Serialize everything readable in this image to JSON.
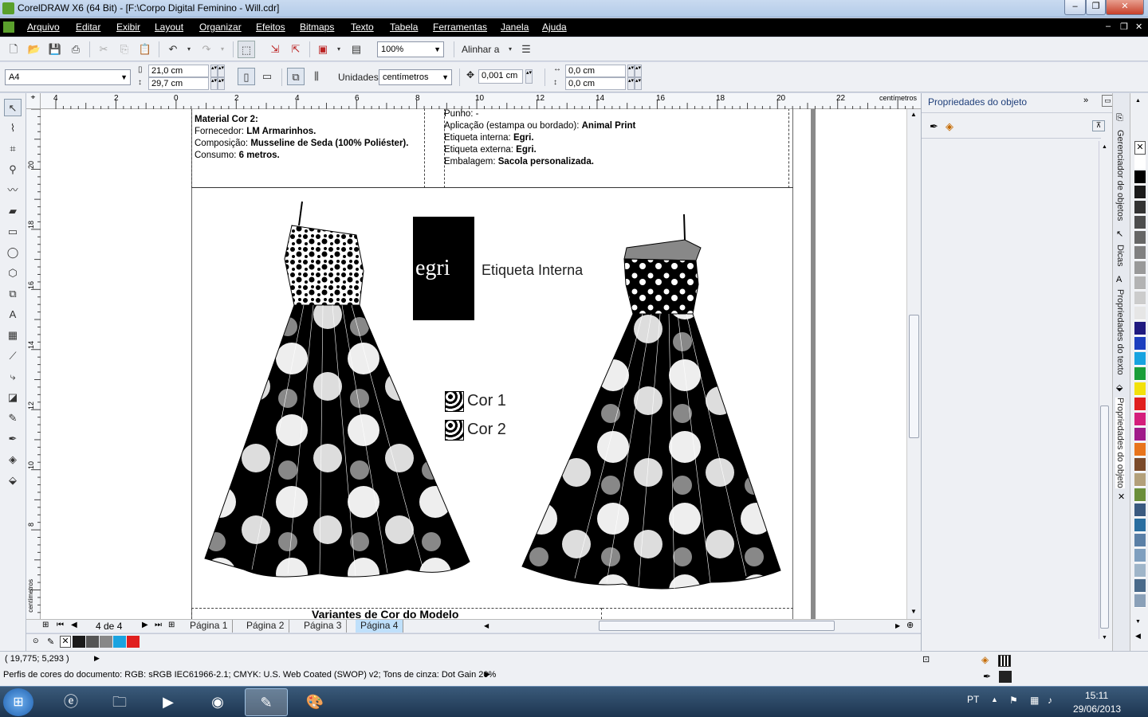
{
  "window": {
    "title": "CorelDRAW X6 (64 Bit) - [F:\\Corpo Digital Feminino - Will.cdr]",
    "min": "–",
    "max": "❐",
    "close": "✕"
  },
  "menu": [
    "Arquivo",
    "Editar",
    "Exibir",
    "Layout",
    "Organizar",
    "Efeitos",
    "Bitmaps",
    "Texto",
    "Tabela",
    "Ferramentas",
    "Janela",
    "Ajuda"
  ],
  "mdi": {
    "min": "–",
    "restore": "❐",
    "close": "✕"
  },
  "toolbar": {
    "zoom": "100%",
    "align_label": "Alinhar a"
  },
  "propbar": {
    "paper": "A4",
    "width": "21,0 cm",
    "height": "29,7 cm",
    "units_label": "Unidades:",
    "units": "centímetros",
    "nudge": "0,001 cm",
    "dup_x": "0,0 cm",
    "dup_y": "0,0 cm"
  },
  "ruler": {
    "h_ticks": [
      "4",
      "2",
      "0",
      "2",
      "4",
      "6",
      "8",
      "10",
      "12",
      "14",
      "16",
      "18",
      "20",
      "22"
    ],
    "h_unit": "centímetros",
    "v_ticks": [
      "20",
      "18",
      "16",
      "14",
      "12",
      "10",
      "8"
    ],
    "v_unit": "centímetros"
  },
  "spec_left": {
    "l1": "Material Cor 2:",
    "l2a": "Fornecedor: ",
    "l2b": "LM Armarinhos.",
    "l3a": "Composição: ",
    "l3b": "Musseline de Seda (100% Poliéster).",
    "l4a": "Consumo: ",
    "l4b": "6 metros."
  },
  "spec_right": {
    "l0": "Punho: -",
    "l1a": "Aplicação (estampa ou bordado): ",
    "l1b": "Animal Print",
    "l2a": "Etiqueta interna: ",
    "l2b": "Egri.",
    "l3a": "Etiqueta externa: ",
    "l3b": "Egri.",
    "l4a": "Embalagem: ",
    "l4b": "Sacola personalizada."
  },
  "label": {
    "brand": "egri",
    "caption": "Etiqueta Interna"
  },
  "colors": {
    "c1": "Cor 1",
    "c2": "Cor 2"
  },
  "footer_title": "Variantes de Cor do Modelo",
  "pages": {
    "counter": "4 de 4",
    "tabs": [
      "Página 1",
      "Página 2",
      "Página 3",
      "Página 4"
    ],
    "active": "Página 4"
  },
  "docker": {
    "title": "Propriedades do objeto",
    "tabs": [
      "Gerenciador de objetos",
      "Dicas",
      "Propriedades do texto",
      "Propriedades do objeto"
    ]
  },
  "palette_colors": [
    "#ffffff",
    "#000000",
    "#1a1a1a",
    "#333333",
    "#4d4d4d",
    "#666666",
    "#808080",
    "#999999",
    "#b3b3b3",
    "#cccccc",
    "#e6e6e6",
    "#1f1a80",
    "#1c3fbf",
    "#17a3e0",
    "#1a9e3a",
    "#f2e10c",
    "#e01f1f",
    "#d41e7c",
    "#a01b8a",
    "#e8741c",
    "#7a4a2a",
    "#b3a07a",
    "#6b8f3a",
    "#3a5a80",
    "#2a6ea0",
    "#5a7fa6",
    "#7f9fbf",
    "#9fb5c9",
    "#4a6a8a",
    "#8aa0b8"
  ],
  "docpal": [
    "#1a1a1a",
    "#555555",
    "#888888",
    "#1aa3e0",
    "#e01f1f"
  ],
  "status": {
    "coords": "( 19,775; 5,293 )",
    "profile": "Perfis de cores do documento: RGB: sRGB IEC61966-2.1; CMYK: U.S. Web Coated (SWOP) v2; Tons de cinza: Dot Gain 20%"
  },
  "tray": {
    "lang": "PT",
    "time": "15:11",
    "date": "29/06/2013"
  }
}
